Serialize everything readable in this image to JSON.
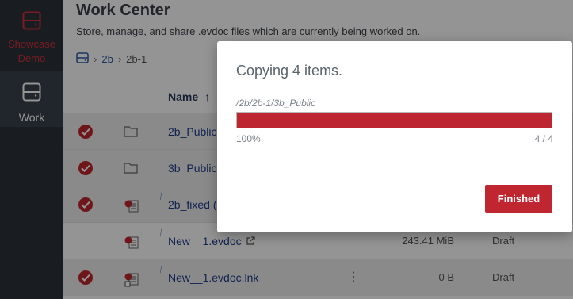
{
  "sidebar": {
    "items": [
      {
        "label": "Showcase Demo",
        "icon": "drive-icon",
        "color": "#d0303a"
      },
      {
        "label": "Work",
        "icon": "drive-icon",
        "color": "#ffffff"
      }
    ]
  },
  "page": {
    "title": "Work Center",
    "subtitle": "Store, manage, and share .evdoc files which are currently being worked on."
  },
  "breadcrumb": {
    "root_icon": "drive-icon",
    "items": [
      "2b",
      "2b-1"
    ]
  },
  "table": {
    "column_name_header": "Name",
    "sort_indicator": "↑",
    "rows": [
      {
        "name": "2b_Public",
        "type": "folder",
        "selected": true
      },
      {
        "name": "3b_Public",
        "type": "folder",
        "selected": true
      },
      {
        "name": "2b_fixed (",
        "type": "evdoc",
        "selected": true
      },
      {
        "name": "New__1.evdoc",
        "type": "evdoc",
        "selected": false,
        "size": "243.41 MiB",
        "status": "Draft"
      },
      {
        "name": "New__1.evdoc.lnk",
        "type": "evdoc-link",
        "selected": true,
        "size": "0 B",
        "status": "Draft",
        "menu": "⋮"
      }
    ]
  },
  "dialog": {
    "title": "Copying 4 items.",
    "path": "/2b/2b-1/3b_Public",
    "progress": 1.0,
    "percent_label": "100%",
    "count_label": "4 / 4",
    "button_label": "Finished",
    "accent": "#bd2630"
  }
}
